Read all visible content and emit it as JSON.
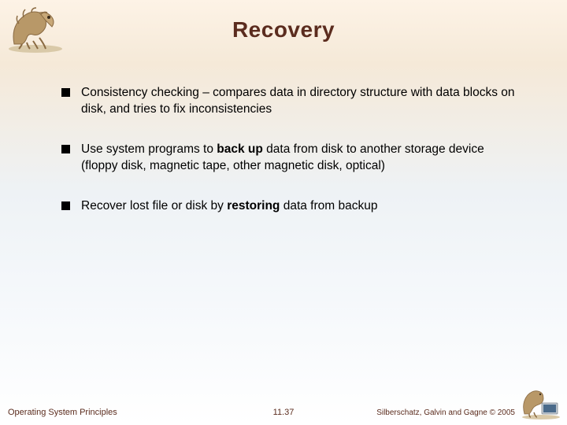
{
  "title": "Recovery",
  "bullets": [
    {
      "segments": [
        {
          "text": "Consistency checking – compares data in directory structure with data blocks on disk, and tries to fix inconsistencies",
          "bold": false
        }
      ]
    },
    {
      "segments": [
        {
          "text": "Use system programs to ",
          "bold": false
        },
        {
          "text": "back up",
          "bold": true
        },
        {
          "text": " data from disk to another storage device (floppy disk, magnetic tape, other magnetic disk, optical)",
          "bold": false
        }
      ]
    },
    {
      "segments": [
        {
          "text": "Recover lost file or disk by ",
          "bold": false
        },
        {
          "text": "restoring",
          "bold": true
        },
        {
          "text": " data from backup",
          "bold": false
        }
      ]
    }
  ],
  "footer": {
    "left": "Operating System Principles",
    "center": "11.37",
    "right": "Silberschatz, Galvin and Gagne © 2005"
  },
  "logos": {
    "top": "dinosaur-logo",
    "bottom": "dinosaur-computer-logo"
  }
}
